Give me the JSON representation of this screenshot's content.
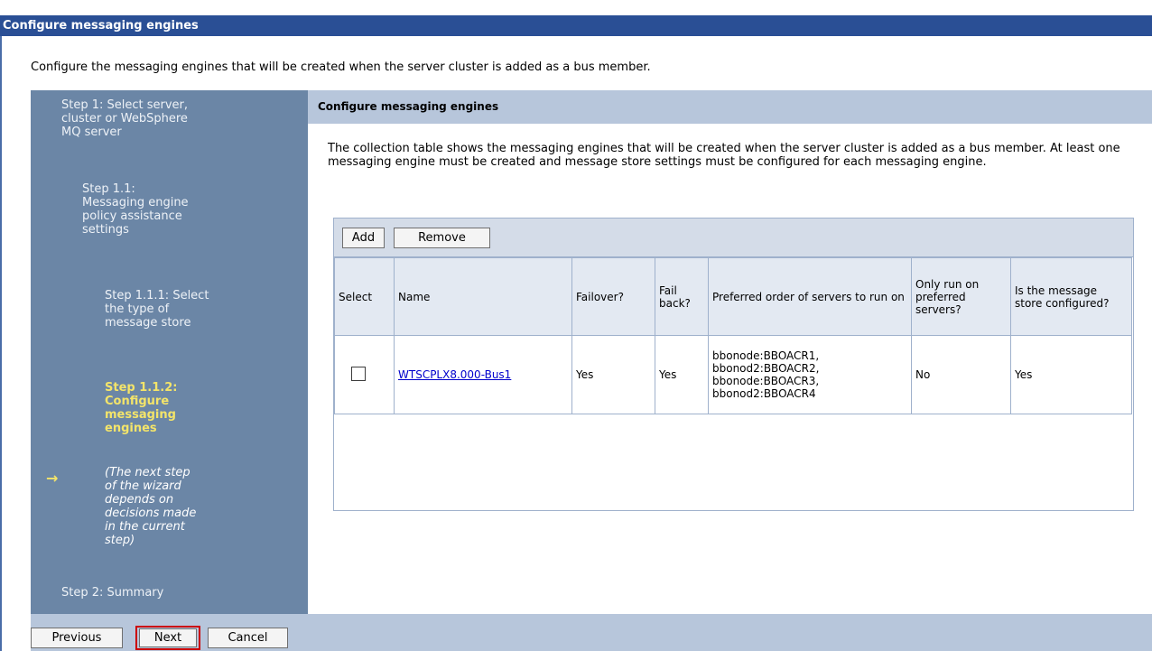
{
  "window": {
    "title": "Configure messaging engines"
  },
  "intro": "Configure the messaging engines that will be created when the server cluster is added as a bus member.",
  "sidebar": {
    "step1": "Step 1: Select server, cluster or WebSphere MQ server",
    "step1_1": "Step 1.1: Messaging engine policy assistance settings",
    "step1_1_1": "Step 1.1.1: Select the type of message store",
    "step1_1_2": "Step 1.1.2: Configure messaging engines",
    "note": "(The next step of the wizard depends on decisions made in the current step)",
    "step2": "Step 2: Summary",
    "current_arrow": "→"
  },
  "main": {
    "header": "Configure messaging engines",
    "description": "The collection table shows the messaging engines that will be created when the server cluster is added as a bus member. At least one messaging engine must be created and message store settings must be configured for each messaging engine."
  },
  "table": {
    "add_label": "Add",
    "remove_label": "Remove",
    "columns": {
      "select": "Select",
      "name": "Name",
      "failover": "Failover?",
      "failback": "Fail back?",
      "preferred_order": "Preferred order of servers to run on",
      "only_preferred": "Only run on preferred servers?",
      "store_configured": "Is the message store configured?"
    },
    "rows": [
      {
        "selected": false,
        "name": "WTSCPLX8.000-Bus1",
        "failover": "Yes",
        "failback": "Yes",
        "preferred_servers": [
          "bbonode:BBOACR1,",
          "bbonod2:BBOACR2,",
          "bbonode:BBOACR3,",
          "bbonod2:BBOACR4"
        ],
        "only_preferred": "No",
        "store_configured": "Yes"
      }
    ]
  },
  "footer": {
    "previous_label": "Previous",
    "next_label": "Next",
    "cancel_label": "Cancel"
  },
  "colors": {
    "title_bar": "#2a4f95",
    "sidebar": "#6b86a6",
    "current_step": "#f3e46a",
    "header_band": "#b7c6db",
    "highlight_border": "#cc0000"
  }
}
